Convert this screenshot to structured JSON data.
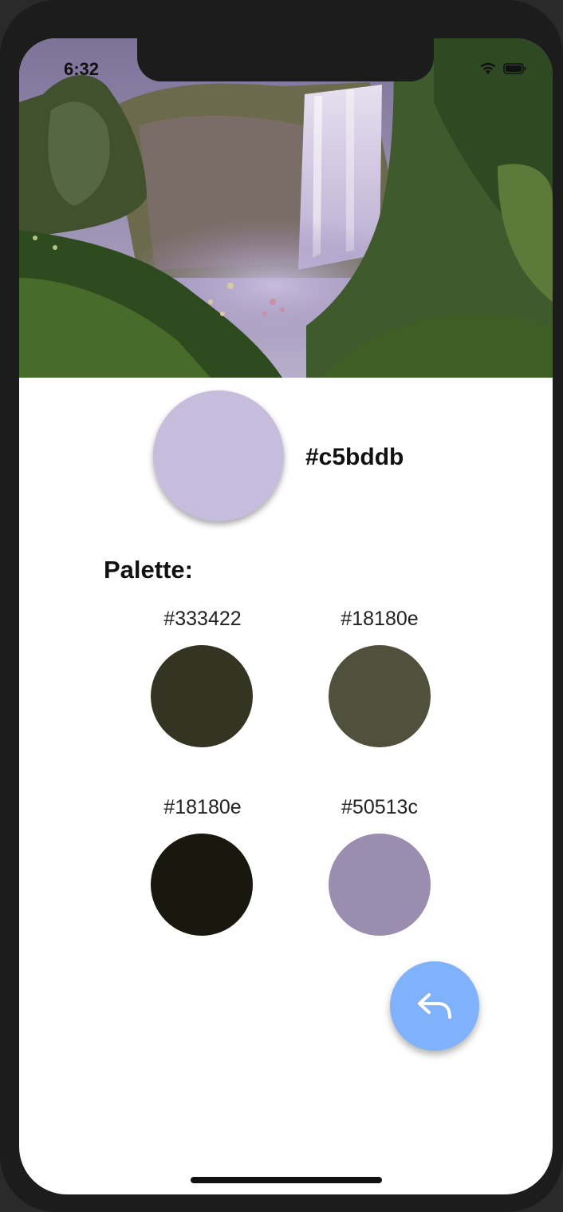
{
  "status_bar": {
    "time": "6:32",
    "icons": [
      "wifi-icon",
      "battery-icon"
    ]
  },
  "hero_image": {
    "subject": "waterfall-landscape"
  },
  "main_color": {
    "hex": "#c5bddb",
    "swatch_color": "#c5bddb"
  },
  "palette": {
    "title": "Palette:",
    "items": [
      {
        "label": "#333422",
        "color": "#333422"
      },
      {
        "label": "#18180e",
        "color": "#50513c"
      },
      {
        "label": "#18180e",
        "color": "#18180e"
      },
      {
        "label": "#50513c",
        "color": "#9b8db0"
      }
    ]
  },
  "fab": {
    "icon": "reply-arrow-icon",
    "color": "#7fb2fb"
  },
  "colors": {
    "device_frame": "#1c1c1c",
    "background": "#ffffff",
    "text": "#111111"
  }
}
